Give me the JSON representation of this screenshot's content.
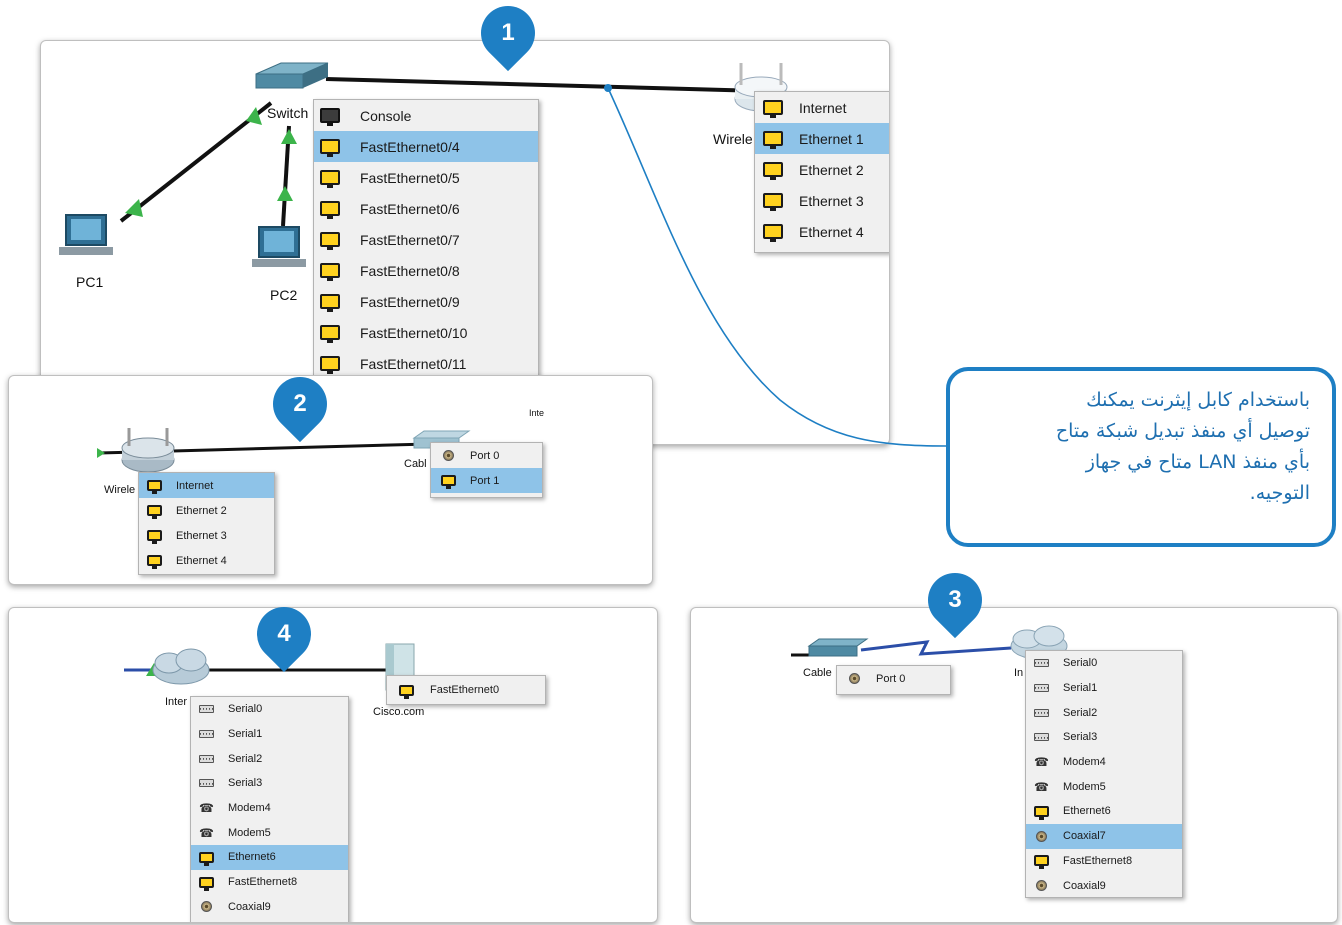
{
  "panel1": {
    "badge": "1",
    "switch_label": "Switch",
    "pc1_label": "PC1",
    "pc2_label": "PC2",
    "router_label": "Wirele",
    "switch_menu": [
      {
        "label": "Console",
        "icon": "console-port-icon",
        "selected": false
      },
      {
        "label": "FastEthernet0/4",
        "icon": "ethernet-port-icon",
        "selected": true
      },
      {
        "label": "FastEthernet0/5",
        "icon": "ethernet-port-icon",
        "selected": false
      },
      {
        "label": "FastEthernet0/6",
        "icon": "ethernet-port-icon",
        "selected": false
      },
      {
        "label": "FastEthernet0/7",
        "icon": "ethernet-port-icon",
        "selected": false
      },
      {
        "label": "FastEthernet0/8",
        "icon": "ethernet-port-icon",
        "selected": false
      },
      {
        "label": "FastEthernet0/9",
        "icon": "ethernet-port-icon",
        "selected": false
      },
      {
        "label": "FastEthernet0/10",
        "icon": "ethernet-port-icon",
        "selected": false
      },
      {
        "label": "FastEthernet0/11",
        "icon": "ethernet-port-icon",
        "selected": false
      }
    ],
    "router_menu": [
      {
        "label": "Internet",
        "icon": "ethernet-port-icon",
        "selected": false
      },
      {
        "label": "Ethernet 1",
        "icon": "ethernet-port-icon",
        "selected": true
      },
      {
        "label": "Ethernet 2",
        "icon": "ethernet-port-icon",
        "selected": false
      },
      {
        "label": "Ethernet 3",
        "icon": "ethernet-port-icon",
        "selected": false
      },
      {
        "label": "Ethernet 4",
        "icon": "ethernet-port-icon",
        "selected": false
      }
    ]
  },
  "panel2": {
    "badge": "2",
    "router_label": "Wirele",
    "cable_label": "Cabl",
    "partial_label": "Inte",
    "router_menu": [
      {
        "label": "Internet",
        "icon": "ethernet-port-icon",
        "selected": true
      },
      {
        "label": "Ethernet 2",
        "icon": "ethernet-port-icon",
        "selected": false
      },
      {
        "label": "Ethernet 3",
        "icon": "ethernet-port-icon",
        "selected": false
      },
      {
        "label": "Ethernet 4",
        "icon": "ethernet-port-icon",
        "selected": false
      }
    ],
    "modem_menu": [
      {
        "label": "Port 0",
        "icon": "coaxial-port-icon",
        "selected": false
      },
      {
        "label": "Port 1",
        "icon": "ethernet-port-icon",
        "selected": true
      }
    ]
  },
  "panel3": {
    "badge": "3",
    "cable_label": "Cable",
    "cloud_label": "In",
    "modem_menu": [
      {
        "label": "Port 0",
        "icon": "coaxial-port-icon",
        "selected": false
      }
    ],
    "cloud_menu": [
      {
        "label": "Serial0",
        "icon": "serial-port-icon",
        "selected": false
      },
      {
        "label": "Serial1",
        "icon": "serial-port-icon",
        "selected": false
      },
      {
        "label": "Serial2",
        "icon": "serial-port-icon",
        "selected": false
      },
      {
        "label": "Serial3",
        "icon": "serial-port-icon",
        "selected": false
      },
      {
        "label": "Modem4",
        "icon": "modem-port-icon",
        "selected": false
      },
      {
        "label": "Modem5",
        "icon": "modem-port-icon",
        "selected": false
      },
      {
        "label": "Ethernet6",
        "icon": "ethernet-port-icon",
        "selected": false
      },
      {
        "label": "Coaxial7",
        "icon": "coaxial-port-icon",
        "selected": true
      },
      {
        "label": "FastEthernet8",
        "icon": "ethernet-port-icon",
        "selected": false
      },
      {
        "label": "Coaxial9",
        "icon": "coaxial-port-icon",
        "selected": false
      }
    ]
  },
  "panel4": {
    "badge": "4",
    "cloud_label": "Inter",
    "server_label": "Cisco.com",
    "cloud_menu": [
      {
        "label": "Serial0",
        "icon": "serial-port-icon",
        "selected": false
      },
      {
        "label": "Serial1",
        "icon": "serial-port-icon",
        "selected": false
      },
      {
        "label": "Serial2",
        "icon": "serial-port-icon",
        "selected": false
      },
      {
        "label": "Serial3",
        "icon": "serial-port-icon",
        "selected": false
      },
      {
        "label": "Modem4",
        "icon": "modem-port-icon",
        "selected": false
      },
      {
        "label": "Modem5",
        "icon": "modem-port-icon",
        "selected": false
      },
      {
        "label": "Ethernet6",
        "icon": "ethernet-port-icon",
        "selected": true
      },
      {
        "label": "FastEthernet8",
        "icon": "ethernet-port-icon",
        "selected": false
      },
      {
        "label": "Coaxial9",
        "icon": "coaxial-port-icon",
        "selected": false
      }
    ],
    "server_menu": [
      {
        "label": "FastEthernet0",
        "icon": "ethernet-port-icon",
        "selected": false
      }
    ]
  },
  "callout": {
    "lines": [
      "باستخدام كابل إيثرنت يمكنك",
      "توصيل أي منفذ تبديل شبكة متاح",
      "بأي منفذ LAN متاح في جهاز",
      "التوجيه."
    ]
  },
  "colors": {
    "accent": "#1e7fc4",
    "selection": "#8ec3e8",
    "port_yellow": "#ffd21f",
    "link_green": "#3cb44b",
    "cable_blue": "#2b4ea8"
  }
}
